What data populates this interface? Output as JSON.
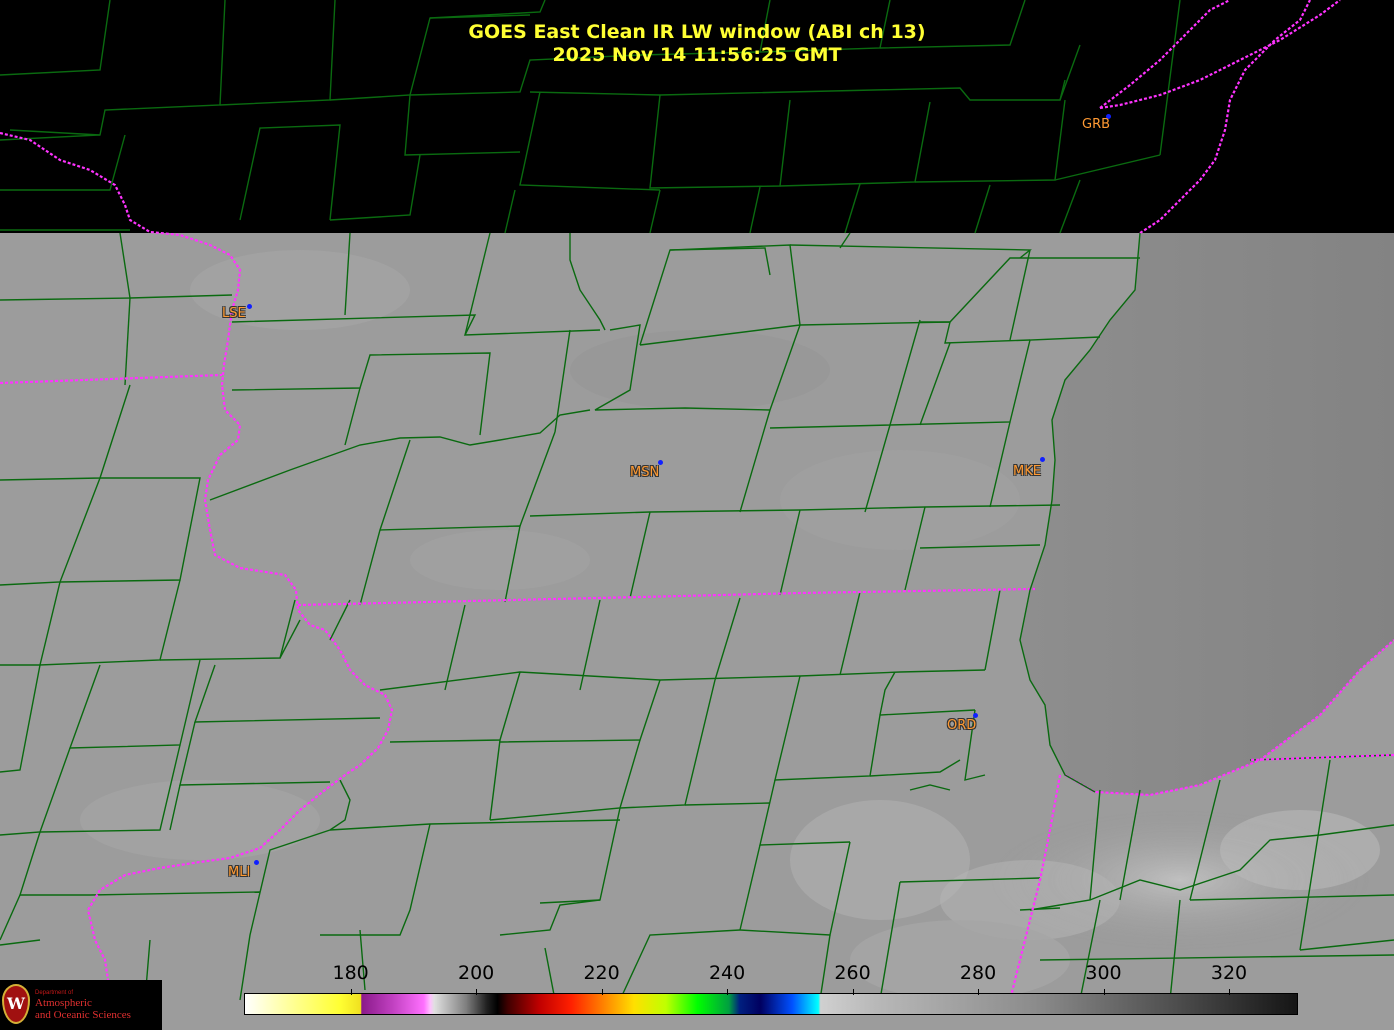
{
  "title": {
    "line1": "GOES East Clean IR LW window (ABI ch 13)",
    "line2": "2025 Nov 14  11:56:25 GMT"
  },
  "stations": [
    {
      "code": "GRB"
    },
    {
      "code": "LSE"
    },
    {
      "code": "MSN"
    },
    {
      "code": "MKE"
    },
    {
      "code": "ORD"
    },
    {
      "code": "MLI"
    }
  ],
  "colorbar": {
    "ticks": [
      "180",
      "200",
      "220",
      "240",
      "260",
      "280",
      "300",
      "320"
    ],
    "unit_range": [
      163,
      331
    ]
  },
  "colors": {
    "land_gray": "#9c9c9c",
    "lake_gray": "#8a8a8a",
    "county_lines": "#0a6a10",
    "state_borders": "#ff33ff",
    "title": "#ffff33",
    "station_label": "#ff9a33",
    "station_dot": "#1020ff"
  },
  "logo": {
    "dept": "Department of",
    "line1": "Atmospheric",
    "line2": "and Oceanic Sciences"
  }
}
